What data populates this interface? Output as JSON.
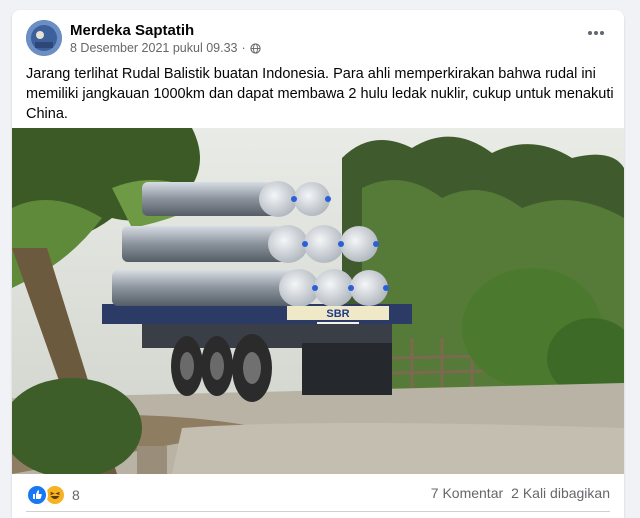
{
  "post": {
    "author": "Merdeka Saptatih",
    "date": "8 Desember 2021 pukul 09.33",
    "privacy_icon": "globe-icon",
    "text": "Jarang terlihat Rudal Balistik buatan Indonesia. Para ahli memperkirakan bahwa rudal ini memiliki jangkauan 1000km dan dapat membawa 2 hulu ledak nuklir, cukup untuk menakuti China."
  },
  "photo": {
    "truck_sign": "SBR"
  },
  "footer": {
    "reaction_icons": [
      "like-icon",
      "haha-icon"
    ],
    "reaction_count": "8",
    "comments": "7 Komentar",
    "shares": "2 Kali dibagikan"
  },
  "colors": {
    "accent": "#1877f2",
    "secondary_text": "#65676b"
  }
}
